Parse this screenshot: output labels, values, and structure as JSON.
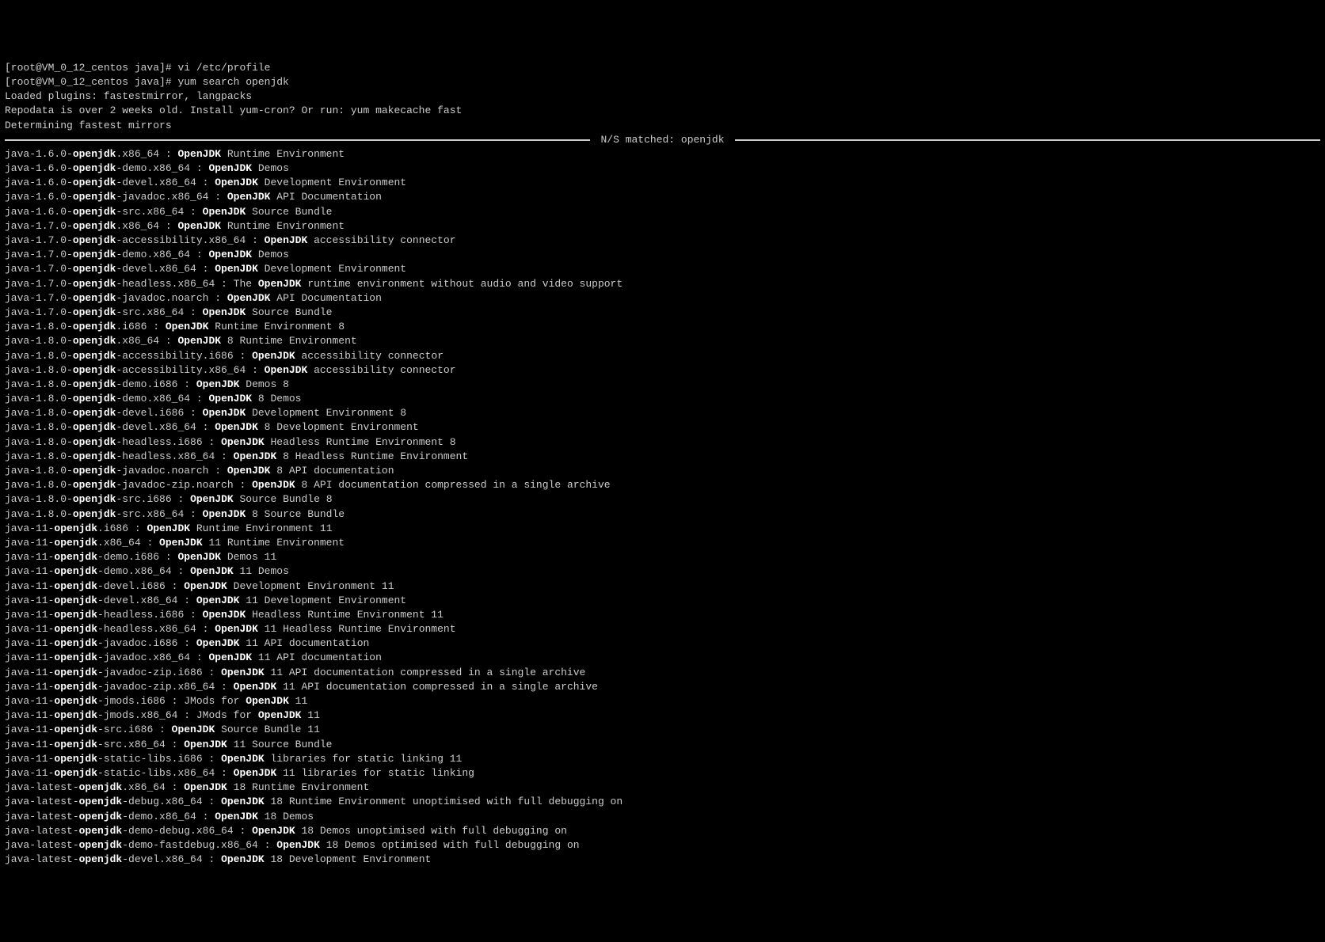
{
  "prompt": "[root@VM_0_12_centos java]# ",
  "cmd1": "vi /etc/profile",
  "cmd2": "yum search openjdk",
  "msg_plugins": "Loaded plugins: fastestmirror, langpacks",
  "msg_repodata": "Repodata is over 2 weeks old. Install yum-cron? Or run: yum makecache fast",
  "msg_mirrors": "Determining fastest mirrors",
  "sep_label": " N/S matched: openjdk ",
  "results": [
    {
      "pre": "java-1.6.0-",
      "b1": "openjdk",
      "mid": ".x86_64 : ",
      "b2": "OpenJDK",
      "post": " Runtime Environment"
    },
    {
      "pre": "java-1.6.0-",
      "b1": "openjdk",
      "mid": "-demo.x86_64 : ",
      "b2": "OpenJDK",
      "post": " Demos"
    },
    {
      "pre": "java-1.6.0-",
      "b1": "openjdk",
      "mid": "-devel.x86_64 : ",
      "b2": "OpenJDK",
      "post": " Development Environment"
    },
    {
      "pre": "java-1.6.0-",
      "b1": "openjdk",
      "mid": "-javadoc.x86_64 : ",
      "b2": "OpenJDK",
      "post": " API Documentation"
    },
    {
      "pre": "java-1.6.0-",
      "b1": "openjdk",
      "mid": "-src.x86_64 : ",
      "b2": "OpenJDK",
      "post": " Source Bundle"
    },
    {
      "pre": "java-1.7.0-",
      "b1": "openjdk",
      "mid": ".x86_64 : ",
      "b2": "OpenJDK",
      "post": " Runtime Environment"
    },
    {
      "pre": "java-1.7.0-",
      "b1": "openjdk",
      "mid": "-accessibility.x86_64 : ",
      "b2": "OpenJDK",
      "post": " accessibility connector"
    },
    {
      "pre": "java-1.7.0-",
      "b1": "openjdk",
      "mid": "-demo.x86_64 : ",
      "b2": "OpenJDK",
      "post": " Demos"
    },
    {
      "pre": "java-1.7.0-",
      "b1": "openjdk",
      "mid": "-devel.x86_64 : ",
      "b2": "OpenJDK",
      "post": " Development Environment"
    },
    {
      "pre": "java-1.7.0-",
      "b1": "openjdk",
      "mid": "-headless.x86_64 : The ",
      "b2": "OpenJDK",
      "post": " runtime environment without audio and video support"
    },
    {
      "pre": "java-1.7.0-",
      "b1": "openjdk",
      "mid": "-javadoc.noarch : ",
      "b2": "OpenJDK",
      "post": " API Documentation"
    },
    {
      "pre": "java-1.7.0-",
      "b1": "openjdk",
      "mid": "-src.x86_64 : ",
      "b2": "OpenJDK",
      "post": " Source Bundle"
    },
    {
      "pre": "java-1.8.0-",
      "b1": "openjdk",
      "mid": ".i686 : ",
      "b2": "OpenJDK",
      "post": " Runtime Environment 8"
    },
    {
      "pre": "java-1.8.0-",
      "b1": "openjdk",
      "mid": ".x86_64 : ",
      "b2": "OpenJDK",
      "post": " 8 Runtime Environment"
    },
    {
      "pre": "java-1.8.0-",
      "b1": "openjdk",
      "mid": "-accessibility.i686 : ",
      "b2": "OpenJDK",
      "post": " accessibility connector"
    },
    {
      "pre": "java-1.8.0-",
      "b1": "openjdk",
      "mid": "-accessibility.x86_64 : ",
      "b2": "OpenJDK",
      "post": " accessibility connector"
    },
    {
      "pre": "java-1.8.0-",
      "b1": "openjdk",
      "mid": "-demo.i686 : ",
      "b2": "OpenJDK",
      "post": " Demos 8"
    },
    {
      "pre": "java-1.8.0-",
      "b1": "openjdk",
      "mid": "-demo.x86_64 : ",
      "b2": "OpenJDK",
      "post": " 8 Demos"
    },
    {
      "pre": "java-1.8.0-",
      "b1": "openjdk",
      "mid": "-devel.i686 : ",
      "b2": "OpenJDK",
      "post": " Development Environment 8"
    },
    {
      "pre": "java-1.8.0-",
      "b1": "openjdk",
      "mid": "-devel.x86_64 : ",
      "b2": "OpenJDK",
      "post": " 8 Development Environment"
    },
    {
      "pre": "java-1.8.0-",
      "b1": "openjdk",
      "mid": "-headless.i686 : ",
      "b2": "OpenJDK",
      "post": " Headless Runtime Environment 8"
    },
    {
      "pre": "java-1.8.0-",
      "b1": "openjdk",
      "mid": "-headless.x86_64 : ",
      "b2": "OpenJDK",
      "post": " 8 Headless Runtime Environment"
    },
    {
      "pre": "java-1.8.0-",
      "b1": "openjdk",
      "mid": "-javadoc.noarch : ",
      "b2": "OpenJDK",
      "post": " 8 API documentation"
    },
    {
      "pre": "java-1.8.0-",
      "b1": "openjdk",
      "mid": "-javadoc-zip.noarch : ",
      "b2": "OpenJDK",
      "post": " 8 API documentation compressed in a single archive"
    },
    {
      "pre": "java-1.8.0-",
      "b1": "openjdk",
      "mid": "-src.i686 : ",
      "b2": "OpenJDK",
      "post": " Source Bundle 8"
    },
    {
      "pre": "java-1.8.0-",
      "b1": "openjdk",
      "mid": "-src.x86_64 : ",
      "b2": "OpenJDK",
      "post": " 8 Source Bundle"
    },
    {
      "pre": "java-11-",
      "b1": "openjdk",
      "mid": ".i686 : ",
      "b2": "OpenJDK",
      "post": " Runtime Environment 11"
    },
    {
      "pre": "java-11-",
      "b1": "openjdk",
      "mid": ".x86_64 : ",
      "b2": "OpenJDK",
      "post": " 11 Runtime Environment"
    },
    {
      "pre": "java-11-",
      "b1": "openjdk",
      "mid": "-demo.i686 : ",
      "b2": "OpenJDK",
      "post": " Demos 11"
    },
    {
      "pre": "java-11-",
      "b1": "openjdk",
      "mid": "-demo.x86_64 : ",
      "b2": "OpenJDK",
      "post": " 11 Demos"
    },
    {
      "pre": "java-11-",
      "b1": "openjdk",
      "mid": "-devel.i686 : ",
      "b2": "OpenJDK",
      "post": " Development Environment 11"
    },
    {
      "pre": "java-11-",
      "b1": "openjdk",
      "mid": "-devel.x86_64 : ",
      "b2": "OpenJDK",
      "post": " 11 Development Environment"
    },
    {
      "pre": "java-11-",
      "b1": "openjdk",
      "mid": "-headless.i686 : ",
      "b2": "OpenJDK",
      "post": " Headless Runtime Environment 11"
    },
    {
      "pre": "java-11-",
      "b1": "openjdk",
      "mid": "-headless.x86_64 : ",
      "b2": "OpenJDK",
      "post": " 11 Headless Runtime Environment"
    },
    {
      "pre": "java-11-",
      "b1": "openjdk",
      "mid": "-javadoc.i686 : ",
      "b2": "OpenJDK",
      "post": " 11 API documentation"
    },
    {
      "pre": "java-11-",
      "b1": "openjdk",
      "mid": "-javadoc.x86_64 : ",
      "b2": "OpenJDK",
      "post": " 11 API documentation"
    },
    {
      "pre": "java-11-",
      "b1": "openjdk",
      "mid": "-javadoc-zip.i686 : ",
      "b2": "OpenJDK",
      "post": " 11 API documentation compressed in a single archive"
    },
    {
      "pre": "java-11-",
      "b1": "openjdk",
      "mid": "-javadoc-zip.x86_64 : ",
      "b2": "OpenJDK",
      "post": " 11 API documentation compressed in a single archive"
    },
    {
      "pre": "java-11-",
      "b1": "openjdk",
      "mid": "-jmods.i686 : JMods for ",
      "b2": "OpenJDK",
      "post": " 11"
    },
    {
      "pre": "java-11-",
      "b1": "openjdk",
      "mid": "-jmods.x86_64 : JMods for ",
      "b2": "OpenJDK",
      "post": " 11"
    },
    {
      "pre": "java-11-",
      "b1": "openjdk",
      "mid": "-src.i686 : ",
      "b2": "OpenJDK",
      "post": " Source Bundle 11"
    },
    {
      "pre": "java-11-",
      "b1": "openjdk",
      "mid": "-src.x86_64 : ",
      "b2": "OpenJDK",
      "post": " 11 Source Bundle"
    },
    {
      "pre": "java-11-",
      "b1": "openjdk",
      "mid": "-static-libs.i686 : ",
      "b2": "OpenJDK",
      "post": " libraries for static linking 11"
    },
    {
      "pre": "java-11-",
      "b1": "openjdk",
      "mid": "-static-libs.x86_64 : ",
      "b2": "OpenJDK",
      "post": " 11 libraries for static linking"
    },
    {
      "pre": "java-latest-",
      "b1": "openjdk",
      "mid": ".x86_64 : ",
      "b2": "OpenJDK",
      "post": " 18 Runtime Environment"
    },
    {
      "pre": "java-latest-",
      "b1": "openjdk",
      "mid": "-debug.x86_64 : ",
      "b2": "OpenJDK",
      "post": " 18 Runtime Environment unoptimised with full debugging on"
    },
    {
      "pre": "java-latest-",
      "b1": "openjdk",
      "mid": "-demo.x86_64 : ",
      "b2": "OpenJDK",
      "post": " 18 Demos"
    },
    {
      "pre": "java-latest-",
      "b1": "openjdk",
      "mid": "-demo-debug.x86_64 : ",
      "b2": "OpenJDK",
      "post": " 18 Demos unoptimised with full debugging on"
    },
    {
      "pre": "java-latest-",
      "b1": "openjdk",
      "mid": "-demo-fastdebug.x86_64 : ",
      "b2": "OpenJDK",
      "post": " 18 Demos optimised with full debugging on"
    },
    {
      "pre": "java-latest-",
      "b1": "openjdk",
      "mid": "-devel.x86_64 : ",
      "b2": "OpenJDK",
      "post": " 18 Development Environment"
    }
  ]
}
